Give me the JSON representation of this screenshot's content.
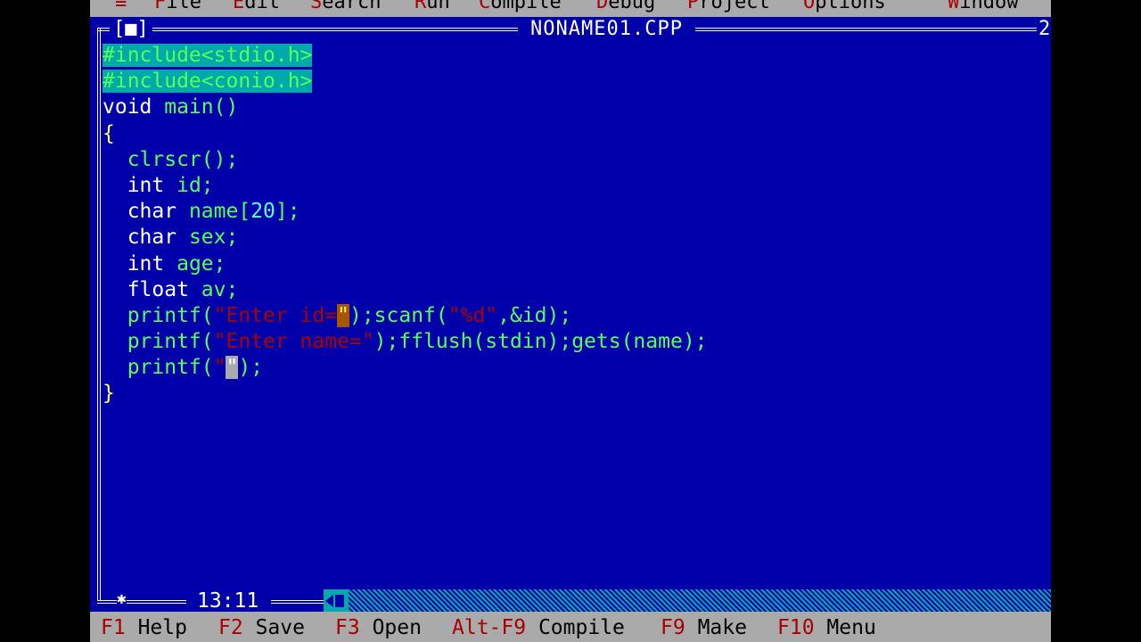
{
  "menu": {
    "system": "≡",
    "items": [
      {
        "hot": "F",
        "rest": "ile"
      },
      {
        "hot": "E",
        "rest": "dit"
      },
      {
        "hot": "S",
        "rest": "earch"
      },
      {
        "hot": "R",
        "rest": "un"
      },
      {
        "hot": "C",
        "rest": "ompile"
      },
      {
        "hot": "D",
        "rest": "ebug"
      },
      {
        "hot": "P",
        "rest": "roject"
      },
      {
        "hot": "O",
        "rest": "ptions"
      },
      {
        "hot": "W",
        "rest": "indow"
      }
    ]
  },
  "window": {
    "close_box": "[■]",
    "title": "NONAME01.CPP",
    "number": "2",
    "cursor_position": "13:11"
  },
  "code": {
    "l1": "#include<stdio.h>",
    "l2": "#include<conio.h>",
    "l3a": "void",
    "l3b": " main()",
    "l4": "{",
    "l5": "  clrscr();",
    "l6a": "  int",
    "l6b": " id;",
    "l7a": "  char",
    "l7b": " name[",
    "l7c": "20",
    "l7d": "];",
    "l8a": "  char",
    "l8b": " sex;",
    "l9a": "  int",
    "l9b": " age;",
    "l10a": "  float",
    "l10b": " av;",
    "l11a": "  printf(",
    "l11b": "\"Enter id=",
    "l11c": "\"",
    "l11d": ");scanf(",
    "l11e": "\"%d\"",
    "l11f": ",&id);",
    "l12a": "  printf(",
    "l12b": "\"Enter name=\"",
    "l12c": ");fflush(stdin);gets(name);",
    "l13a": "  printf(",
    "l13b": "\"",
    "l13c": "\"",
    "l13d": ");",
    "l14": "}"
  },
  "hints": [
    {
      "key": "F1",
      "label": "Help"
    },
    {
      "key": "F2",
      "label": "Save"
    },
    {
      "key": "F3",
      "label": "Open"
    },
    {
      "key": "Alt-F9",
      "label": "Compile"
    },
    {
      "key": "F9",
      "label": "Make"
    },
    {
      "key": "F10",
      "label": "Menu"
    }
  ]
}
